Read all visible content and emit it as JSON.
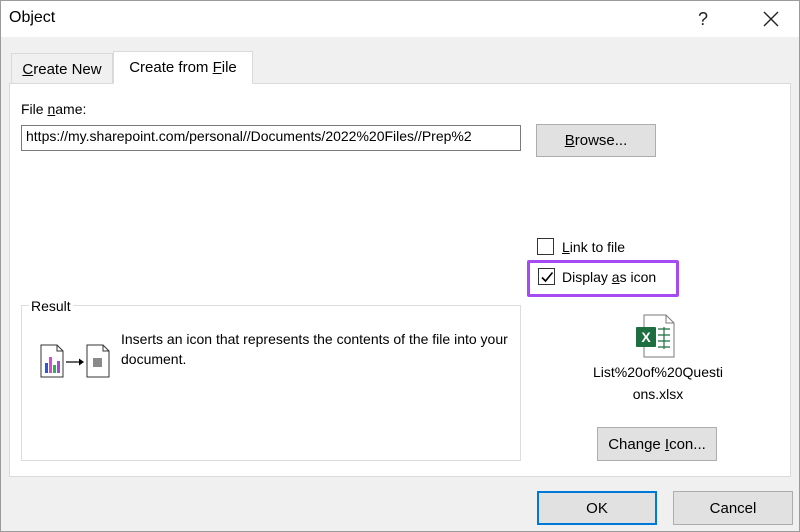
{
  "dialog": {
    "title": "Object",
    "help_label": "?"
  },
  "tabs": [
    {
      "pre": "",
      "key": "C",
      "post": "reate New"
    },
    {
      "pre": "Create from ",
      "key": "F",
      "post": "ile"
    }
  ],
  "file_name": {
    "label_pre": "File ",
    "label_key": "n",
    "label_post": "ame:",
    "value": "https://my.sharepoint.com/personal//Documents/2022%20Files//Prep%2"
  },
  "browse": {
    "key": "B",
    "post": "rowse..."
  },
  "options": {
    "link": {
      "pre": "",
      "key": "L",
      "post": "ink to file",
      "checked": false
    },
    "display": {
      "pre": "Display ",
      "key": "a",
      "post": "s icon",
      "checked": true
    }
  },
  "result": {
    "legend": "Result",
    "description": "Inserts an icon that represents the contents of the file into your document."
  },
  "icon_preview": {
    "line1": "List%20of%20Questi",
    "line2": "ons.xlsx",
    "app_letter": "X"
  },
  "change_icon": {
    "pre": "Change ",
    "key": "I",
    "post": "con..."
  },
  "buttons": {
    "ok": "OK",
    "cancel": "Cancel"
  },
  "colors": {
    "highlight": "#a64bf4",
    "excel_green": "#1d6f42",
    "ok_border": "#0078d7"
  }
}
